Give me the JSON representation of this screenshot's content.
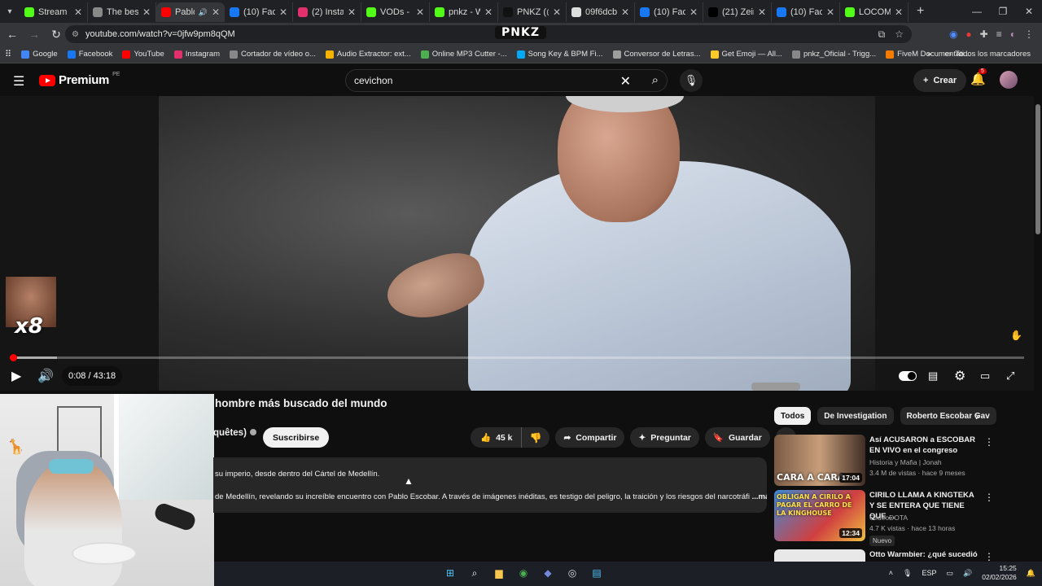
{
  "browser": {
    "tabs": [
      {
        "title": "Stream - K",
        "icon": "kick-icon",
        "color": "#53fc18"
      },
      {
        "title": "The best C",
        "icon": "site-icon",
        "color": "#888888"
      },
      {
        "title": "Pablo I",
        "icon": "youtube-icon",
        "color": "#ff0000",
        "active": true
      },
      {
        "title": "(10) Faceb",
        "icon": "facebook-icon",
        "color": "#1877f2"
      },
      {
        "title": "(2) Instagr",
        "icon": "instagram-icon",
        "color": "#e1306c"
      },
      {
        "title": "VODs - Ki",
        "icon": "kick-icon",
        "color": "#53fc18"
      },
      {
        "title": "pnkz - Wa",
        "icon": "kick-icon",
        "color": "#53fc18"
      },
      {
        "title": "PNKZ (@p",
        "icon": "tiktok-icon",
        "color": "#111111"
      },
      {
        "title": "09f6dcbb",
        "icon": "github-icon",
        "color": "#dddddd"
      },
      {
        "title": "(10) Faceb",
        "icon": "facebook-icon",
        "color": "#1877f2"
      },
      {
        "title": "(21) Zein",
        "icon": "x-icon",
        "color": "#000000"
      },
      {
        "title": "(10) Faceb",
        "icon": "facebook-icon",
        "color": "#1877f2"
      },
      {
        "title": "LOCOMA",
        "icon": "kick-icon",
        "color": "#53fc18"
      }
    ],
    "url": "youtube.com/watch?v=0jfw9pm8qQM",
    "overlay_logo": "PNKZ",
    "bookmarks": [
      {
        "label": "Google",
        "color": "#4285f4"
      },
      {
        "label": "Facebook",
        "color": "#1877f2"
      },
      {
        "label": "YouTube",
        "color": "#ff0000"
      },
      {
        "label": "Instagram",
        "color": "#e1306c"
      },
      {
        "label": "Cortador de vídeo o...",
        "color": "#888888"
      },
      {
        "label": "Audio Extractor: ext...",
        "color": "#f4b400"
      },
      {
        "label": "Online MP3 Cutter -...",
        "color": "#4caf50"
      },
      {
        "label": "Song Key & BPM Fi...",
        "color": "#03a9f4"
      },
      {
        "label": "Conversor de Letras...",
        "color": "#9e9e9e"
      },
      {
        "label": "Get Emoji — All...",
        "color": "#ffca28"
      },
      {
        "label": "pnkz_Oficial - Trigg...",
        "color": "#888888"
      },
      {
        "label": "FiveM Documentati...",
        "color": "#f57c00"
      }
    ],
    "all_bookmarks": "Todos los marcadores"
  },
  "yt": {
    "brand": "Premium",
    "region": "PE",
    "search_query": "cevichon",
    "create_label": "Crear",
    "notif_count": "5"
  },
  "player": {
    "current_time": "0:08",
    "duration": "43:18",
    "progress_fraction": 0.003,
    "sticker_multiplier": "x8"
  },
  "video": {
    "title": "hombre más buscado del mundo",
    "channel": "quêtes)",
    "subscribe_label": "Suscribirse",
    "likes": "45 k",
    "share_label": "Compartir",
    "ask_label": "Preguntar",
    "save_label": "Guardar",
    "desc_line1": "su imperio, desde dentro del Cártel de Medellín.",
    "desc_line2": "de Medellín, revelando su increíble encuentro con Pablo Escobar. A través de imágenes inéditas, es testigo del peligro, la traición y los riesgos del narcotráfi",
    "desc_more": "...más"
  },
  "related": {
    "chips": [
      "Todos",
      "De Investigation",
      "Roberto Escobar Gav"
    ],
    "items": [
      {
        "title": "Así ACUSARON a ESCOBAR EN VIVO en el congreso",
        "channel": "Historia y Mafia | Jonah",
        "meta": "3.4 M de vistas · hace 9 meses",
        "duration": "17:04",
        "thumb_text": "CARA A CARA"
      },
      {
        "title": "CIRILO LLAMA A KINGTEKA Y SE ENTERA QUE TIENE QUE ...",
        "channel": "ClideoDOTA",
        "meta": "4.7 K vistas · hace 13 horas",
        "duration": "12:34",
        "thumb_text": "OBLIGAN A CIRILO A PAGAR EL CARRO DE LA KINGHOUSE",
        "badge": "Nuevo"
      },
      {
        "title": "Otto Warmbier: ¿qué sucedió en",
        "channel": "",
        "meta": "",
        "duration": "",
        "thumb_text": ""
      }
    ]
  },
  "taskbar": {
    "lang": "ESP",
    "time": "15:25",
    "date": "02/02/2026"
  }
}
